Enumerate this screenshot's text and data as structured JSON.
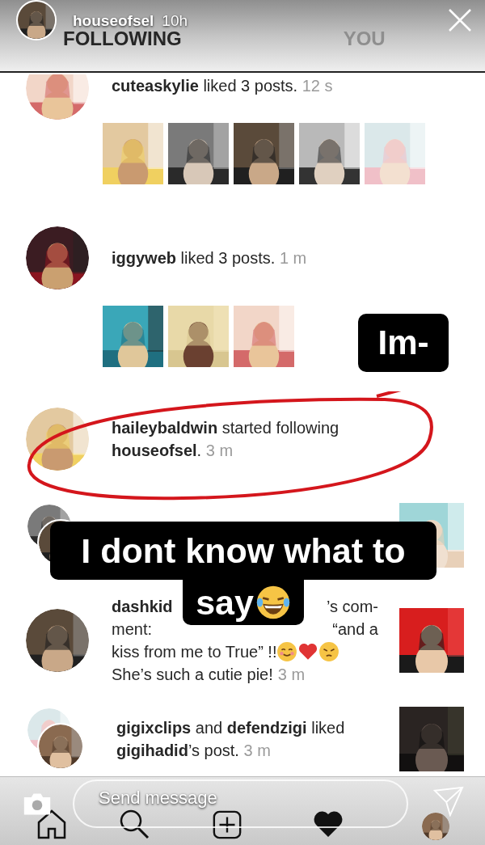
{
  "story": {
    "username": "houseofsel",
    "time": "10h"
  },
  "tabs": [
    {
      "label": "FOLLOWING",
      "selected": true
    },
    {
      "label": "YOU",
      "selected": false
    }
  ],
  "activity": [
    {
      "text": "**cuteaskylie** liked 3 posts.",
      "time": "12 s",
      "highlighted": false,
      "avatars": [
        {
          "kind": "picture"
        }
      ],
      "posts": [
        {
          "kind": "picture"
        },
        {
          "kind": "picture"
        },
        {
          "kind": "picture"
        },
        {
          "kind": "picture"
        },
        {
          "kind": "picture"
        }
      ]
    },
    {
      "text": "**iggyweb** liked 3 posts.",
      "time": "1 m",
      "highlighted": false,
      "avatars": [
        {
          "kind": "picture"
        }
      ],
      "posts": [
        {
          "kind": "picture"
        },
        {
          "kind": "picture"
        },
        {
          "kind": "picture"
        }
      ]
    },
    {
      "text": "**haileybaldwin** started following **houseofsel**.",
      "time": "3 m",
      "highlighted": true,
      "avatars": [
        {
          "kind": "picture"
        }
      ]
    },
    {
      "highlighted": false,
      "avatars": [
        {
          "kind": "picture"
        },
        {
          "kind": "picture"
        }
      ],
      "post": {
        "kind": "picture"
      }
    },
    {
      "highlighted": false,
      "avatars": [
        {
          "kind": "picture"
        }
      ],
      "post": {
        "kind": "picture"
      },
      "time": "3 m",
      "lines": [
        [
          {
            "kind": "text",
            "text": "**dashkid**"
          },
          {
            "kind": "gap"
          },
          {
            "kind": "text",
            "text": "’s com-"
          }
        ],
        [
          {
            "kind": "text",
            "text": "ment:"
          },
          {
            "kind": "gap"
          },
          {
            "kind": "text",
            "text": "“and a"
          }
        ],
        [
          {
            "kind": "text",
            "text": "kiss from me to True” !!"
          },
          {
            "kind": "smiling_emoji"
          },
          {
            "kind": "heart_emoji"
          },
          {
            "kind": "pouting_emoji"
          }
        ],
        [
          {
            "kind": "text",
            "text": "She’s such a cutie pie!"
          }
        ]
      ]
    },
    {
      "text": "**gigixclips** and **defendzigi** liked **gigihadid**’s post.",
      "time": "3 m",
      "highlighted": false,
      "avatars": [
        {
          "kind": "picture"
        },
        {
          "kind": "picture"
        }
      ],
      "post": {
        "kind": "picture"
      }
    }
  ],
  "stickers": [
    {
      "lines": [
        "Im-"
      ]
    },
    {
      "lines": [
        "I dont know what to",
        "say"
      ],
      "icon": {
        "kind": "laughing_emoji"
      }
    }
  ],
  "message_field": {
    "placeholder": "Send message"
  }
}
